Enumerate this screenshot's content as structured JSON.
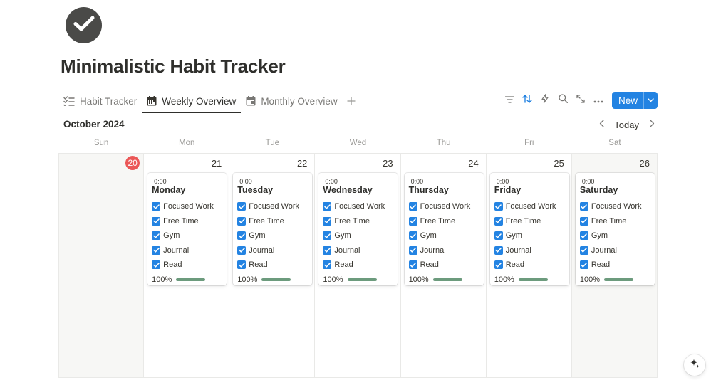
{
  "page": {
    "icon": "check-circle-icon",
    "title": "Minimalistic Habit Tracker"
  },
  "tabs": [
    {
      "label": "Habit Tracker",
      "icon": "checklist-icon",
      "active": false
    },
    {
      "label": "Weekly Overview",
      "icon": "calendar-icon",
      "active": true
    },
    {
      "label": "Monthly Overview",
      "icon": "calendar-page-icon",
      "active": false
    }
  ],
  "toolbar": {
    "icons": [
      "filter-icon",
      "sort-icon",
      "lightning-icon",
      "search-icon",
      "expand-icon",
      "more-icon"
    ],
    "new_label": "New"
  },
  "calendar": {
    "month_label": "October 2024",
    "today_label": "Today",
    "weekday_headers": [
      "Sun",
      "Mon",
      "Tue",
      "Wed",
      "Thu",
      "Fri",
      "Sat"
    ],
    "days": [
      {
        "num": "20",
        "is_today": true,
        "has_card": false
      },
      {
        "num": "21",
        "is_today": false,
        "has_card": true,
        "card": {
          "time": "0:00",
          "name": "Monday",
          "progress_label": "100%",
          "progress": 1.0
        }
      },
      {
        "num": "22",
        "is_today": false,
        "has_card": true,
        "card": {
          "time": "0:00",
          "name": "Tuesday",
          "progress_label": "100%",
          "progress": 1.0
        }
      },
      {
        "num": "23",
        "is_today": false,
        "has_card": true,
        "card": {
          "time": "0:00",
          "name": "Wednesday",
          "progress_label": "100%",
          "progress": 1.0
        }
      },
      {
        "num": "24",
        "is_today": false,
        "has_card": true,
        "card": {
          "time": "0:00",
          "name": "Thursday",
          "progress_label": "100%",
          "progress": 1.0
        }
      },
      {
        "num": "25",
        "is_today": false,
        "has_card": true,
        "card": {
          "time": "0:00",
          "name": "Friday",
          "progress_label": "100%",
          "progress": 1.0
        }
      },
      {
        "num": "26",
        "is_today": false,
        "has_card": true,
        "card": {
          "time": "0:00",
          "name": "Saturday",
          "progress_label": "100%",
          "progress": 1.0
        }
      }
    ],
    "habits": [
      "Focused Work",
      "Free Time",
      "Gym",
      "Journal",
      "Read"
    ]
  },
  "colors": {
    "accent": "#2383e2",
    "today_badge": "#eb5757",
    "progress_fill": "#6c9b7d",
    "weekend_bg": "#f7f7f5"
  },
  "floating": {
    "icon": "ai-sparkle-icon"
  }
}
